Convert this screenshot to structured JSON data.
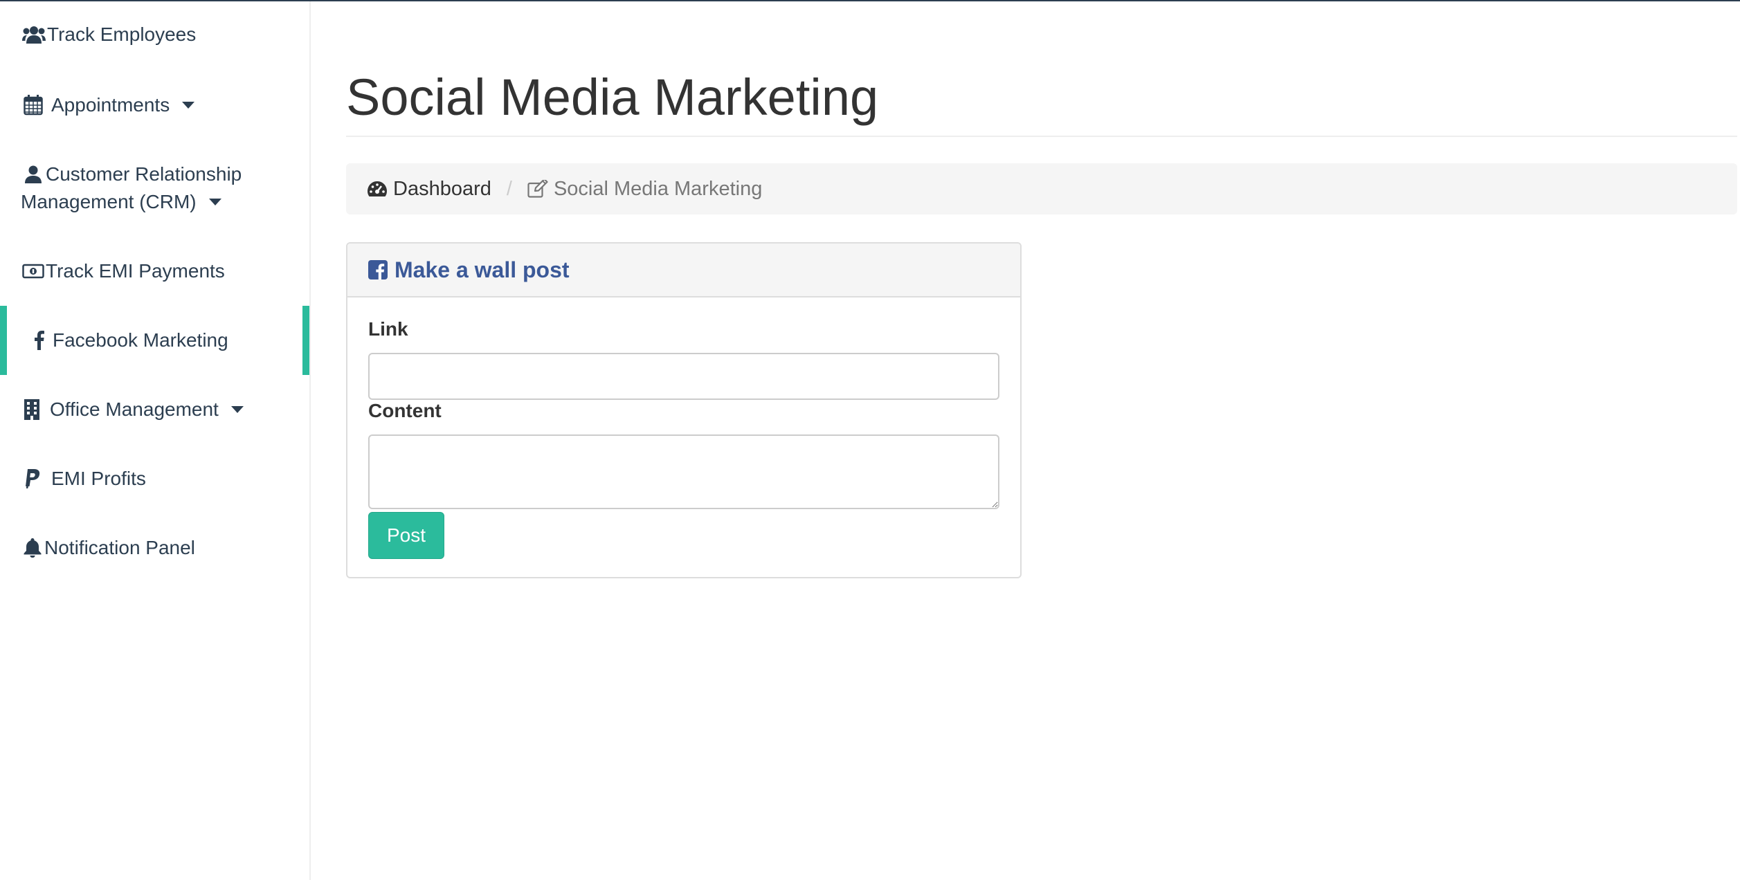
{
  "sidebar": {
    "items": [
      {
        "label": "Track Employees",
        "icon": "users-icon",
        "has_caret": false
      },
      {
        "label": "Appointments",
        "icon": "calendar-icon",
        "has_caret": true
      },
      {
        "label_line1": "Customer Relationship",
        "label_line2": "Management (CRM)",
        "icon": "user-icon",
        "has_caret": true
      },
      {
        "label": "Track EMI Payments",
        "icon": "money-bill-icon",
        "has_caret": false
      },
      {
        "label": "Facebook Marketing",
        "icon": "facebook-f-icon",
        "has_caret": false,
        "active": true
      },
      {
        "label": "Office Management",
        "icon": "building-icon",
        "has_caret": true
      },
      {
        "label": "EMI Profits",
        "icon": "paypal-icon",
        "has_caret": false
      },
      {
        "label": "Notification Panel",
        "icon": "bell-icon",
        "has_caret": false
      }
    ]
  },
  "page": {
    "title": "Social Media Marketing"
  },
  "breadcrumb": {
    "home_label": "Dashboard",
    "separator": "/",
    "current_label": "Social Media Marketing"
  },
  "panel": {
    "heading": "Make a wall post",
    "link_label": "Link",
    "link_value": "",
    "content_label": "Content",
    "content_value": "",
    "post_button": "Post"
  },
  "colors": {
    "accent": "#2bbb9c",
    "facebook_blue": "#3b5998",
    "sidebar_text": "#2c3e50",
    "breadcrumb_bg": "#f5f5f5"
  }
}
